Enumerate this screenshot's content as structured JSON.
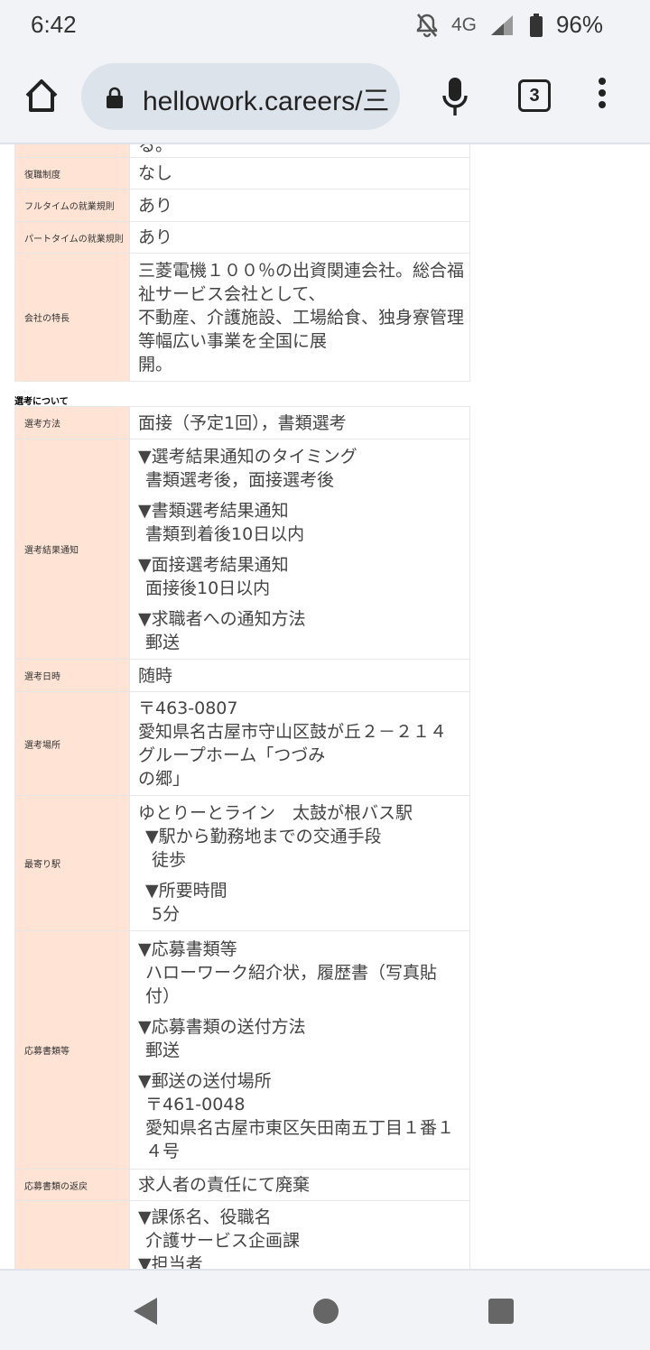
{
  "status_bar": {
    "time": "6:42",
    "network": "4G",
    "battery": "96%"
  },
  "browser": {
    "url": "hellowork.careers/三",
    "tab_count": "3"
  },
  "table1": [
    {
      "label": "",
      "lines": [
        "る。"
      ]
    },
    {
      "label": "復職制度",
      "lines": [
        "なし"
      ]
    },
    {
      "label": "フルタイムの就業規則",
      "lines": [
        "あり"
      ]
    },
    {
      "label": "パートタイムの就業規則",
      "lines": [
        "あり"
      ]
    },
    {
      "label": "会社の特長",
      "lines": [
        "三菱電機１００％の出資関連会社。総合福",
        "祉サービス会社として、",
        "不動産、介護施設、工場給食、独身寮管理",
        "等幅広い事業を全国に展",
        "開。"
      ]
    }
  ],
  "section_heading": "選考について",
  "table2": [
    {
      "label": "選考方法",
      "value": "面接（予定1回），書類選考"
    },
    {
      "label": "選考結果通知",
      "blocks": [
        {
          "head": "▼選考結果通知のタイミング",
          "body": "書類選考後，面接選考後"
        },
        {
          "head": "▼書類選考結果通知",
          "body": "書類到着後10日以内"
        },
        {
          "head": "▼面接選考結果通知",
          "body": "面接後10日以内"
        },
        {
          "head": "▼求職者への通知方法",
          "body": "郵送"
        }
      ]
    },
    {
      "label": "選考日時",
      "value": "随時"
    },
    {
      "label": "選考場所",
      "lines": [
        "〒463-0807",
        "愛知県名古屋市守山区鼓が丘２－２１４",
        "グループホーム「つづみ",
        "の郷」"
      ]
    },
    {
      "label": "最寄り駅",
      "first": "ゆとりーとライン　太鼓が根バス駅",
      "blocks": [
        {
          "head": "▼駅から勤務地までの交通手段",
          "body": "徒歩"
        },
        {
          "head": "▼所要時間",
          "body": "5分"
        }
      ]
    },
    {
      "label": "応募書類等",
      "blocks": [
        {
          "head": "▼応募書類等",
          "body": "ハローワーク紹介状，履歴書（写真貼",
          "body2": "付）"
        },
        {
          "head": "▼応募書類の送付方法",
          "body": "郵送"
        },
        {
          "head": "▼郵送の送付場所",
          "body": "〒461-0048",
          "body2": "愛知県名古屋市東区矢田南五丁目１番１",
          "body3": "４号"
        }
      ]
    },
    {
      "label": "応募書類の返戻",
      "value": "求人者の責任にて廃棄"
    },
    {
      "label": "",
      "blocks": [
        {
          "head": "▼課係名、役職名",
          "body": "介護サービス企画課",
          "body2": "▼担当者"
        }
      ]
    }
  ]
}
